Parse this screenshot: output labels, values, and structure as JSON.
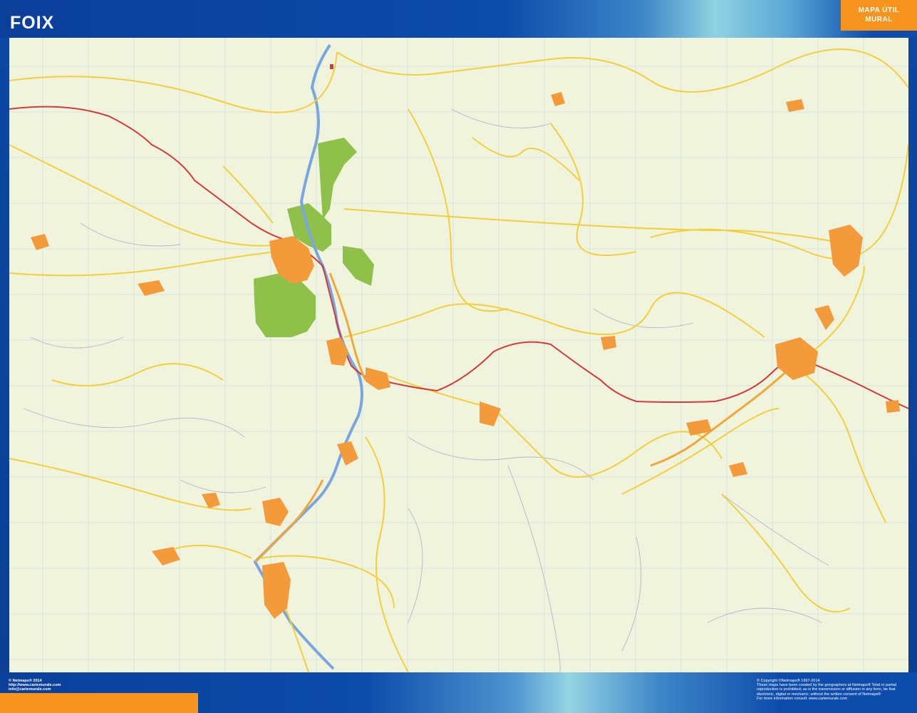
{
  "header": {
    "title": "FOIX",
    "badge_line1": "MAPA ÚTIL",
    "badge_line2": "MURAL"
  },
  "map": {
    "background_color": "#f1f4dd",
    "grid_color": "#c8d9e4",
    "road_primary_color": "#d33a3a",
    "road_secondary_color": "#f2cf3a",
    "river_color": "#7aa6e0",
    "forest_color": "#8fc14a",
    "urban_color": "#f39a3a"
  },
  "footer": {
    "left_lines": [
      "© Netmaps® 2014",
      "http://www.cartemurale.com",
      "info@cartemurale.com"
    ],
    "right_lines": [
      "© Copyright ©Netmaps® 1997-2014",
      "These maps have been created by the geographers at Netmaps® Total or partial",
      "reproduction is prohibited; as is the transmission or diffusion in any form, be that",
      "electronic, digital or mechanic; without the written consent of Netmaps®",
      "For more information consult: www.cartemurale.com"
    ]
  }
}
